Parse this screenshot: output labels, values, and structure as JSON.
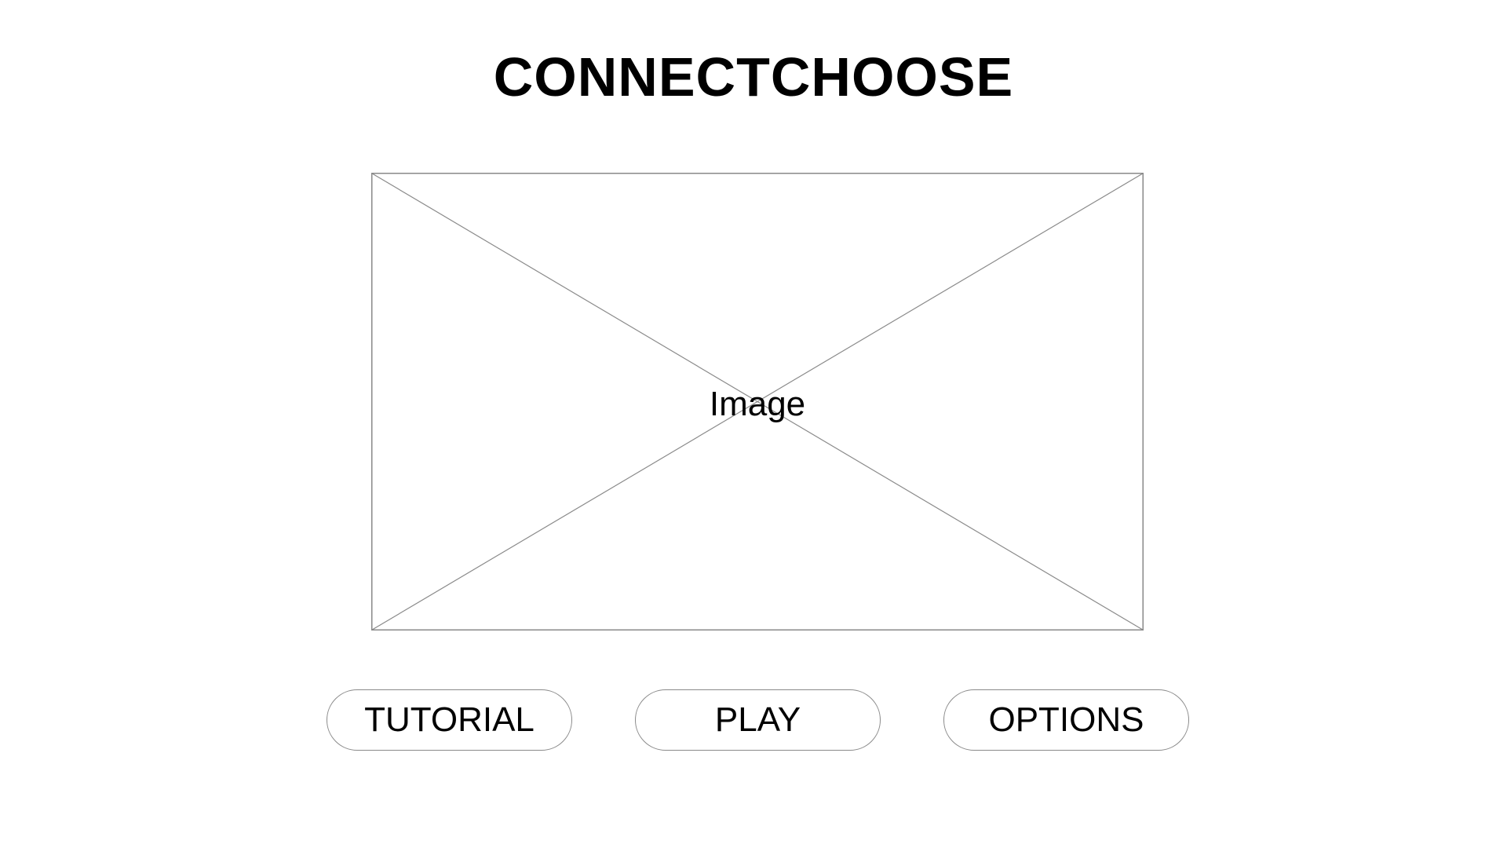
{
  "game": {
    "title": "CONNECTCHOOSE"
  },
  "hero_image": {
    "label": "Image",
    "stroke_color": "#8a8a8a"
  },
  "menu": {
    "tutorial_label": "TUTORIAL",
    "play_label": "PLAY",
    "options_label": "OPTIONS"
  }
}
